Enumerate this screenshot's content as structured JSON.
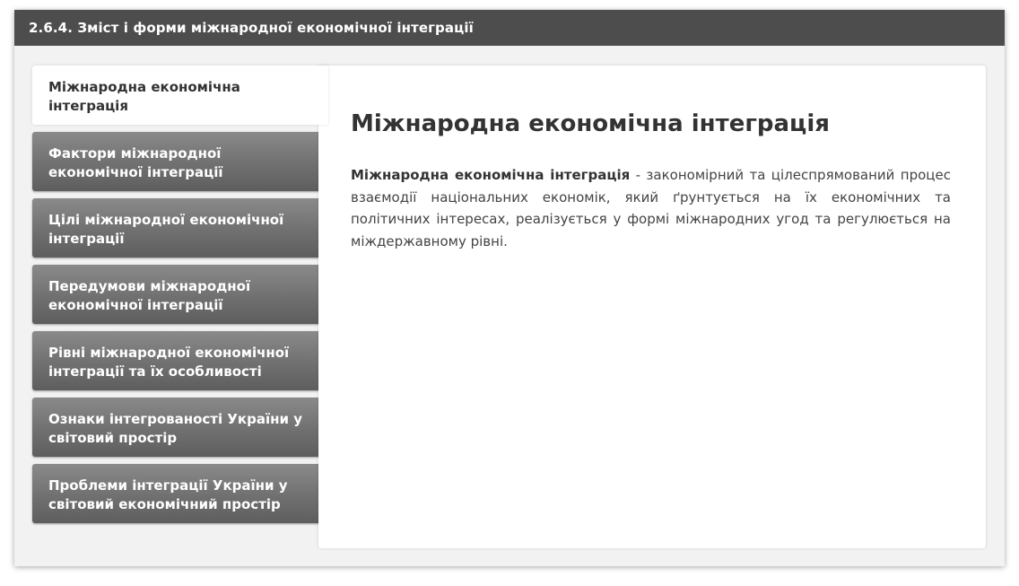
{
  "header": {
    "title": "2.6.4. Зміст і форми міжнародної економічної інтеграції"
  },
  "tabs": [
    {
      "label": "Міжнародна економічна інтеграція",
      "active": true
    },
    {
      "label": "Фактори міжнародної економічної інтеграції",
      "active": false
    },
    {
      "label": "Цілі міжнародної економічної інтеграції",
      "active": false
    },
    {
      "label": "Передумови міжнародної економічної інтеграції",
      "active": false
    },
    {
      "label": "Рівні міжнародної економічної інтеграції та їх особливості",
      "active": false
    },
    {
      "label": "Ознаки інтегрованості України у світовий простір",
      "active": false
    },
    {
      "label": "Проблеми інтеграції України у світовий економічний простір",
      "active": false
    }
  ],
  "content": {
    "title": "Міжнародна економічна інтеграція",
    "term": "Міжнародна економічна інтеграція",
    "definition": " - закономірний та цілеспрямований процес взаємодії національних економік, який ґрунтується на їх економічних та політичних інтересах, реалізується у формі міжнародних угод та регулюється на міждержавному рівні."
  },
  "colors": {
    "header_bg": "#4d4d4d",
    "tab_bg": "#707070",
    "active_tab_bg": "#ffffff",
    "panel_bg": "#ffffff",
    "frame_bg": "#f2f2f2"
  }
}
